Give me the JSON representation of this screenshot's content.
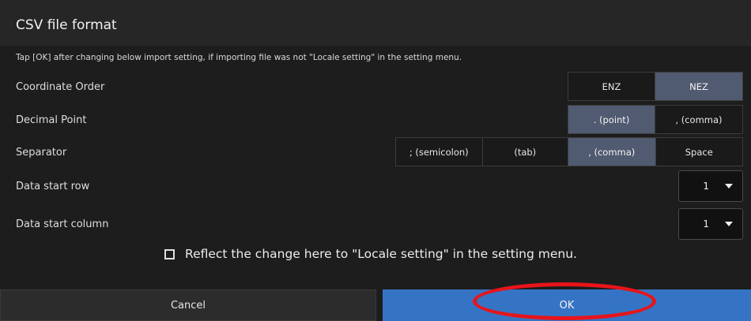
{
  "dialog": {
    "title": "CSV file format",
    "hint": "Tap [OK] after changing below import setting, if importing file was not \"Locale setting\" in the setting menu."
  },
  "settings": {
    "coordinate_order": {
      "label": "Coordinate Order",
      "options": [
        "ENZ",
        "NEZ"
      ],
      "selected": "NEZ"
    },
    "decimal_point": {
      "label": "Decimal Point",
      "options": [
        ". (point)",
        ", (comma)"
      ],
      "selected": ". (point)"
    },
    "separator": {
      "label": "Separator",
      "options": [
        "; (semicolon)",
        "(tab)",
        ", (comma)",
        "Space"
      ],
      "selected": ", (comma)"
    },
    "data_start_row": {
      "label": "Data start row",
      "value": "1"
    },
    "data_start_column": {
      "label": "Data start column",
      "value": "1"
    }
  },
  "reflect": {
    "label": "Reflect the change here to \"Locale setting\" in the setting menu.",
    "checked": false
  },
  "buttons": {
    "cancel": "Cancel",
    "ok": "OK"
  },
  "colors": {
    "selected_option": "#505a70",
    "ok_button": "#3574c4",
    "highlight_ring": "#e8141a"
  }
}
